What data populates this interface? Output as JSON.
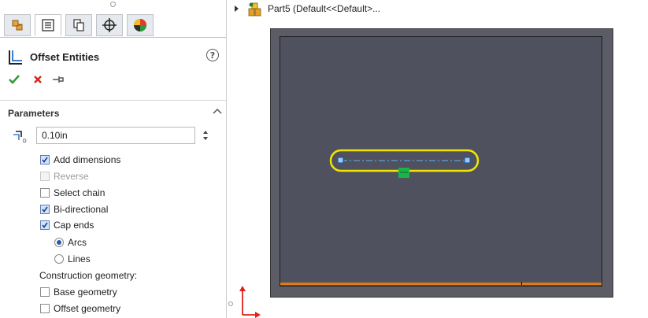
{
  "property_manager": {
    "tabs": [
      {
        "name": "featuremanager-tab",
        "icon": "feature-tree-icon"
      },
      {
        "name": "propertymanager-tab",
        "icon": "property-manager-icon"
      },
      {
        "name": "configurationmanager-tab",
        "icon": "configuration-icon"
      },
      {
        "name": "dimxpertmanager-tab",
        "icon": "dimxpert-crosshair-icon"
      },
      {
        "name": "displaymanager-tab",
        "icon": "display-manager-icon"
      }
    ],
    "active_tab_index": 1,
    "title": "Offset Entities",
    "help_label": "?",
    "actions": {
      "ok": "ok-checkmark-icon",
      "cancel": "cancel-x-icon",
      "pushpin": "pushpin-icon"
    },
    "section": {
      "title": "Parameters",
      "distance_value": "0.10in",
      "options": {
        "add_dimensions": {
          "label": "Add dimensions",
          "checked": true,
          "enabled": true
        },
        "reverse": {
          "label": "Reverse",
          "checked": false,
          "enabled": false
        },
        "select_chain": {
          "label": "Select chain",
          "checked": false,
          "enabled": true
        },
        "bi_directional": {
          "label": "Bi-directional",
          "checked": true,
          "enabled": true
        },
        "cap_ends": {
          "label": "Cap ends",
          "checked": true,
          "enabled": true
        }
      },
      "cap_type": {
        "arcs": {
          "label": "Arcs",
          "selected": true
        },
        "lines": {
          "label": "Lines",
          "selected": false
        }
      },
      "construction_label": "Construction geometry:",
      "construction": {
        "base_geometry": {
          "label": "Base geometry",
          "checked": false
        },
        "offset_geometry": {
          "label": "Offset geometry",
          "checked": false
        }
      }
    }
  },
  "graphics": {
    "tree_label": "Part5  (Default<<Default>...",
    "colors": {
      "background": "#ffffff",
      "frame_outer": "#5c5c66",
      "frame_inner": "#4f515e",
      "offset_contour": "#f2e600",
      "centerline": "#5aa0e0",
      "endpoints": "#3a7fd0",
      "midpoint_marker": "#19b34a",
      "selected_edge": "#e07a16",
      "triad_axes": "#e0201a"
    }
  }
}
